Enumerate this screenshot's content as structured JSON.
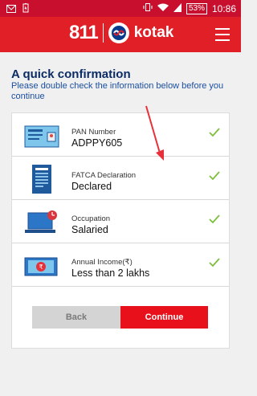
{
  "status_bar": {
    "battery_percent": "53%",
    "time": "10:86"
  },
  "header": {
    "brand_number": "811",
    "brand_name": "kotak"
  },
  "page": {
    "title": "A quick confirmation",
    "subtitle": "Please double check the information below before you continue"
  },
  "fields": [
    {
      "label": "PAN Number",
      "value": "ADPPY605",
      "icon": "pan-card-icon"
    },
    {
      "label": "FATCA Declaration",
      "value": "Declared",
      "icon": "document-icon"
    },
    {
      "label": "Occupation",
      "value": "Salaried",
      "icon": "laptop-icon"
    },
    {
      "label": "Annual Income(₹)",
      "value": "Less than 2 lakhs",
      "icon": "rupee-note-icon"
    }
  ],
  "buttons": {
    "back_label": "Back",
    "continue_label": "Continue"
  },
  "colors": {
    "status_bar": "#c8102e",
    "header": "#e01f26",
    "title_text": "#0b2c64",
    "subtitle_text": "#1b4fa0",
    "check": "#7cbf3b",
    "continue_button": "#e8101a",
    "back_button": "#d4d4d4"
  }
}
